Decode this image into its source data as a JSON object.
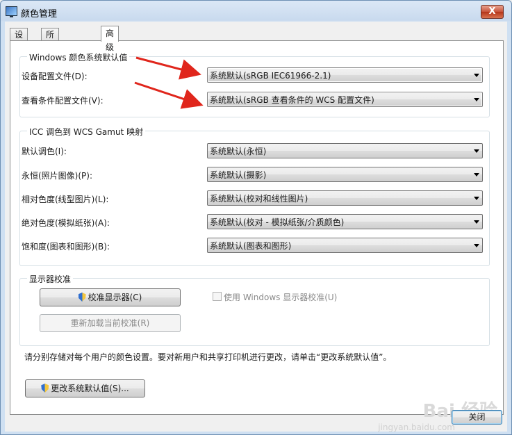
{
  "window": {
    "title": "颜色管理",
    "close_label": "X"
  },
  "tabs": [
    {
      "label": "设备"
    },
    {
      "label": "所有配置文件"
    },
    {
      "label": "高级"
    }
  ],
  "windows_defaults": {
    "title": "Windows 颜色系统默认值",
    "device_profile_label": "设备配置文件(D):",
    "device_profile_value": "系统默认(sRGB IEC61966-2.1)",
    "viewing_profile_label": "查看条件配置文件(V):",
    "viewing_profile_value": "系统默认(sRGB 查看条件的 WCS 配置文件)"
  },
  "gamut_mapping": {
    "title": "ICC 调色到 WCS Gamut 映射",
    "rows": [
      {
        "label": "默认调色(I):",
        "value": "系统默认(永恒)"
      },
      {
        "label": "永恒(照片图像)(P):",
        "value": "系统默认(摄影)"
      },
      {
        "label": "相对色度(线型图片)(L):",
        "value": "系统默认(校对和线性图片)"
      },
      {
        "label": "绝对色度(模拟纸张)(A):",
        "value": "系统默认(校对 - 模拟纸张/介质颜色)"
      },
      {
        "label": "饱和度(图表和图形)(B):",
        "value": "系统默认(图表和图形)"
      }
    ]
  },
  "display_calibration": {
    "title": "显示器校准",
    "calibrate_button": "校准显示器(C)",
    "reload_button": "重新加载当前校准(R)",
    "use_windows_checkbox": "使用 Windows 显示器校准(U)"
  },
  "footer": {
    "note": "请分别存储对每个用户的颜色设置。要对新用户和共享打印机进行更改，请单击“更改系统默认值”。",
    "change_defaults_button": "更改系统默认值(S)...",
    "close_button": "关闭"
  },
  "watermark": {
    "logo": "Bai 经验",
    "url": "jingyan.baidu.com"
  },
  "colors": {
    "annotation_arrow": "#e0261c"
  }
}
